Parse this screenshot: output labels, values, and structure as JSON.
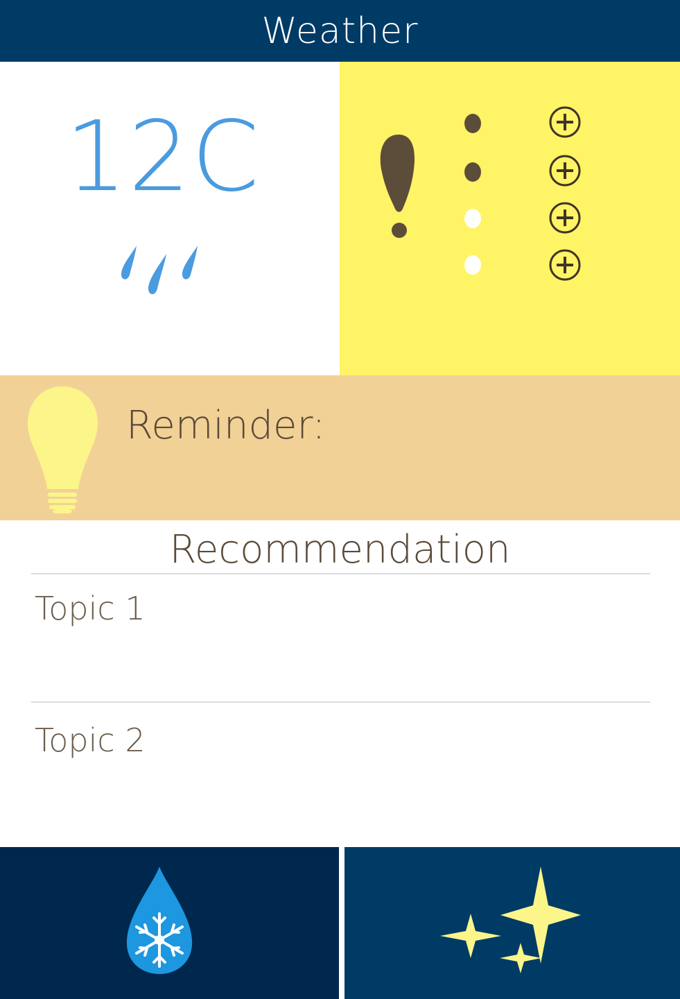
{
  "header": {
    "title": "Weather"
  },
  "weather": {
    "temperature": "12C",
    "condition_icon": "rain-icon",
    "colors": {
      "temp": "#4a9bdf"
    }
  },
  "alerts": {
    "icon": "exclamation-icon",
    "dots": [
      {
        "state": "filled",
        "add_icon": "plus-circle-icon"
      },
      {
        "state": "filled",
        "add_icon": "plus-circle-icon"
      },
      {
        "state": "empty",
        "add_icon": "plus-circle-icon"
      },
      {
        "state": "empty",
        "add_icon": "plus-circle-icon"
      }
    ],
    "colors": {
      "background": "#fff465",
      "mark": "#5c4d3a"
    }
  },
  "reminder": {
    "icon": "lightbulb-icon",
    "label": "Reminder:"
  },
  "recommendation": {
    "title": "Recommendation",
    "topics": [
      {
        "label": "Topic 1"
      },
      {
        "label": "Topic 2"
      }
    ]
  },
  "footer": {
    "left_icon": "snow-drop-icon",
    "right_icon": "sparkles-icon",
    "colors": {
      "left": "#00274d",
      "right": "#003b66",
      "sparkle": "#fcf58a"
    }
  }
}
